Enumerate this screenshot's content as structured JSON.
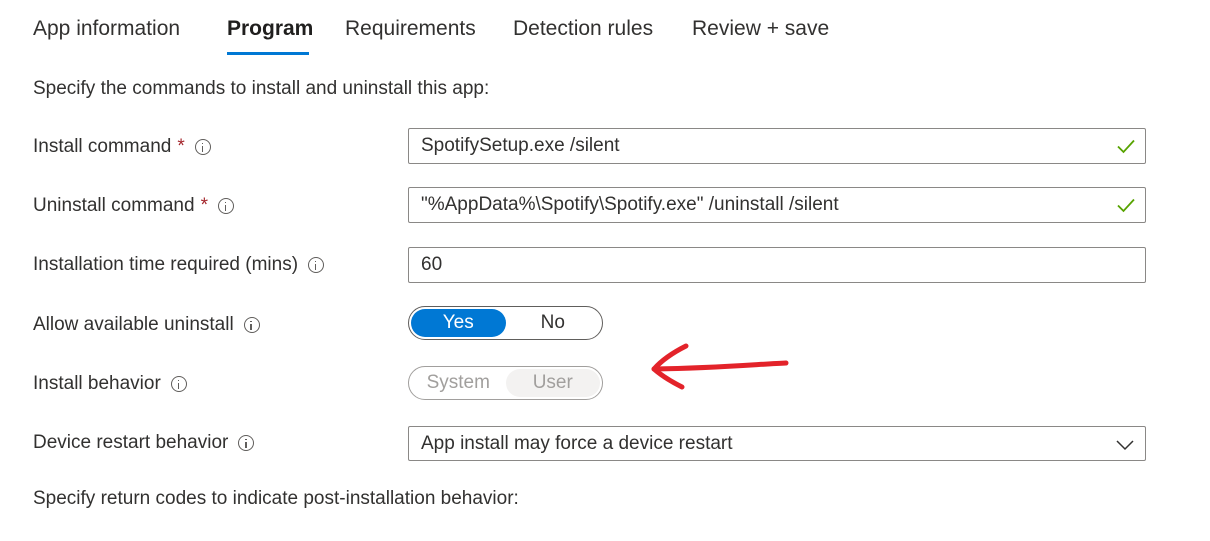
{
  "tabs": [
    {
      "label": "App information"
    },
    {
      "label": "Program"
    },
    {
      "label": "Requirements"
    },
    {
      "label": "Detection rules"
    },
    {
      "label": "Review + save"
    }
  ],
  "active_tab": "Program",
  "intro": "Specify the commands to install and uninstall this app:",
  "fields": {
    "install_command": {
      "label": "Install command",
      "required": "*",
      "value": "SpotifySetup.exe /silent"
    },
    "uninstall_command": {
      "label": "Uninstall command",
      "required": "*",
      "value": "\"%AppData%\\Spotify\\Spotify.exe\" /uninstall /silent"
    },
    "install_time": {
      "label": "Installation time required (mins)",
      "value": "60"
    },
    "allow_uninstall": {
      "label": "Allow available uninstall",
      "options": [
        "Yes",
        "No"
      ],
      "selected": "Yes"
    },
    "install_behavior": {
      "label": "Install behavior",
      "options": [
        "System",
        "User"
      ],
      "selected": "User",
      "disabled": true
    },
    "device_restart": {
      "label": "Device restart behavior",
      "value": "App install may force a device restart"
    }
  },
  "footer": "Specify return codes to indicate post-installation behavior:",
  "colors": {
    "accent": "#0078d4",
    "valid_check": "#57a300",
    "required": "#a4262c",
    "annotation_arrow": "#e3232a"
  },
  "icons": {
    "info": "info-icon",
    "valid": "checkmark-icon",
    "dropdown": "chevron-down-icon",
    "annotation": "red-arrow-annotation"
  }
}
